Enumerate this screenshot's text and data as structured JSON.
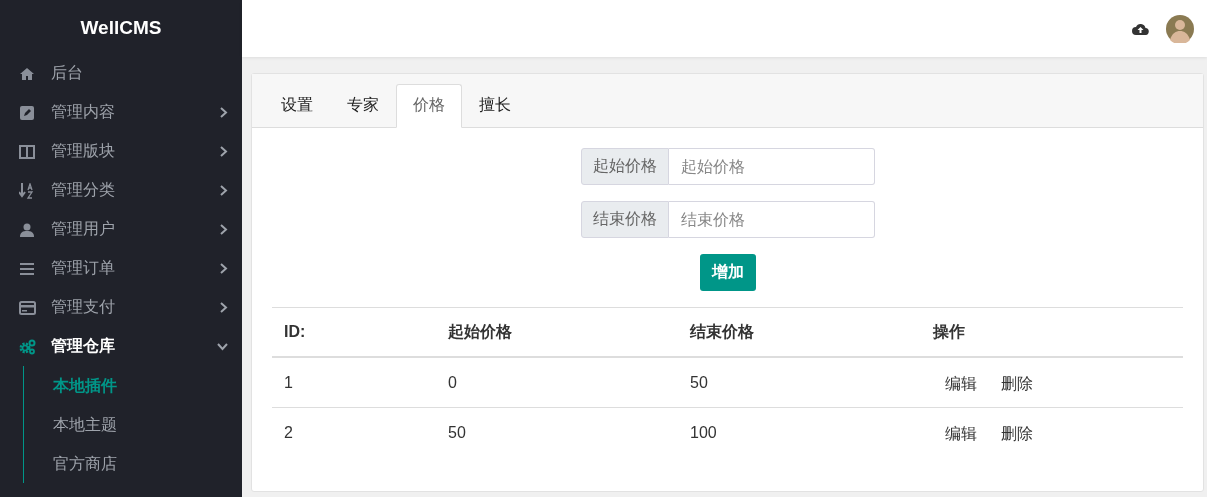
{
  "sidebar": {
    "logo": "WellCMS",
    "items": [
      {
        "label": "后台",
        "kind": "link",
        "selected": false
      },
      {
        "label": "管理内容",
        "kind": "group",
        "expanded": false,
        "selected": false
      },
      {
        "label": "管理版块",
        "kind": "group",
        "expanded": false,
        "selected": false
      },
      {
        "label": "管理分类",
        "kind": "group",
        "expanded": false,
        "selected": false
      },
      {
        "label": "管理用户",
        "kind": "group",
        "expanded": false,
        "selected": false
      },
      {
        "label": "管理订单",
        "kind": "group",
        "expanded": false,
        "selected": false
      },
      {
        "label": "管理支付",
        "kind": "group",
        "expanded": false,
        "selected": false
      },
      {
        "label": "管理仓库",
        "kind": "group",
        "expanded": true,
        "selected": true,
        "children": [
          {
            "label": "本地插件",
            "selected": true
          },
          {
            "label": "本地主题",
            "selected": false
          },
          {
            "label": "官方商店",
            "selected": false
          }
        ]
      }
    ]
  },
  "tabs": [
    {
      "label": "设置",
      "selected": false
    },
    {
      "label": "专家",
      "selected": false
    },
    {
      "label": "价格",
      "selected": true
    },
    {
      "label": "擅长",
      "selected": false
    }
  ],
  "form": {
    "fields": [
      {
        "label": "起始价格",
        "placeholder": "起始价格"
      },
      {
        "label": "结束价格",
        "placeholder": "结束价格"
      }
    ],
    "submit": "增加"
  },
  "table": {
    "columns": [
      "ID:",
      "起始价格",
      "结束价格",
      "操作"
    ],
    "rows": [
      {
        "cells": [
          "1",
          "0",
          "50"
        ],
        "actions": [
          "编辑",
          "删除"
        ]
      },
      {
        "cells": [
          "2",
          "50",
          "100"
        ],
        "actions": [
          "编辑",
          "删除"
        ]
      }
    ]
  }
}
